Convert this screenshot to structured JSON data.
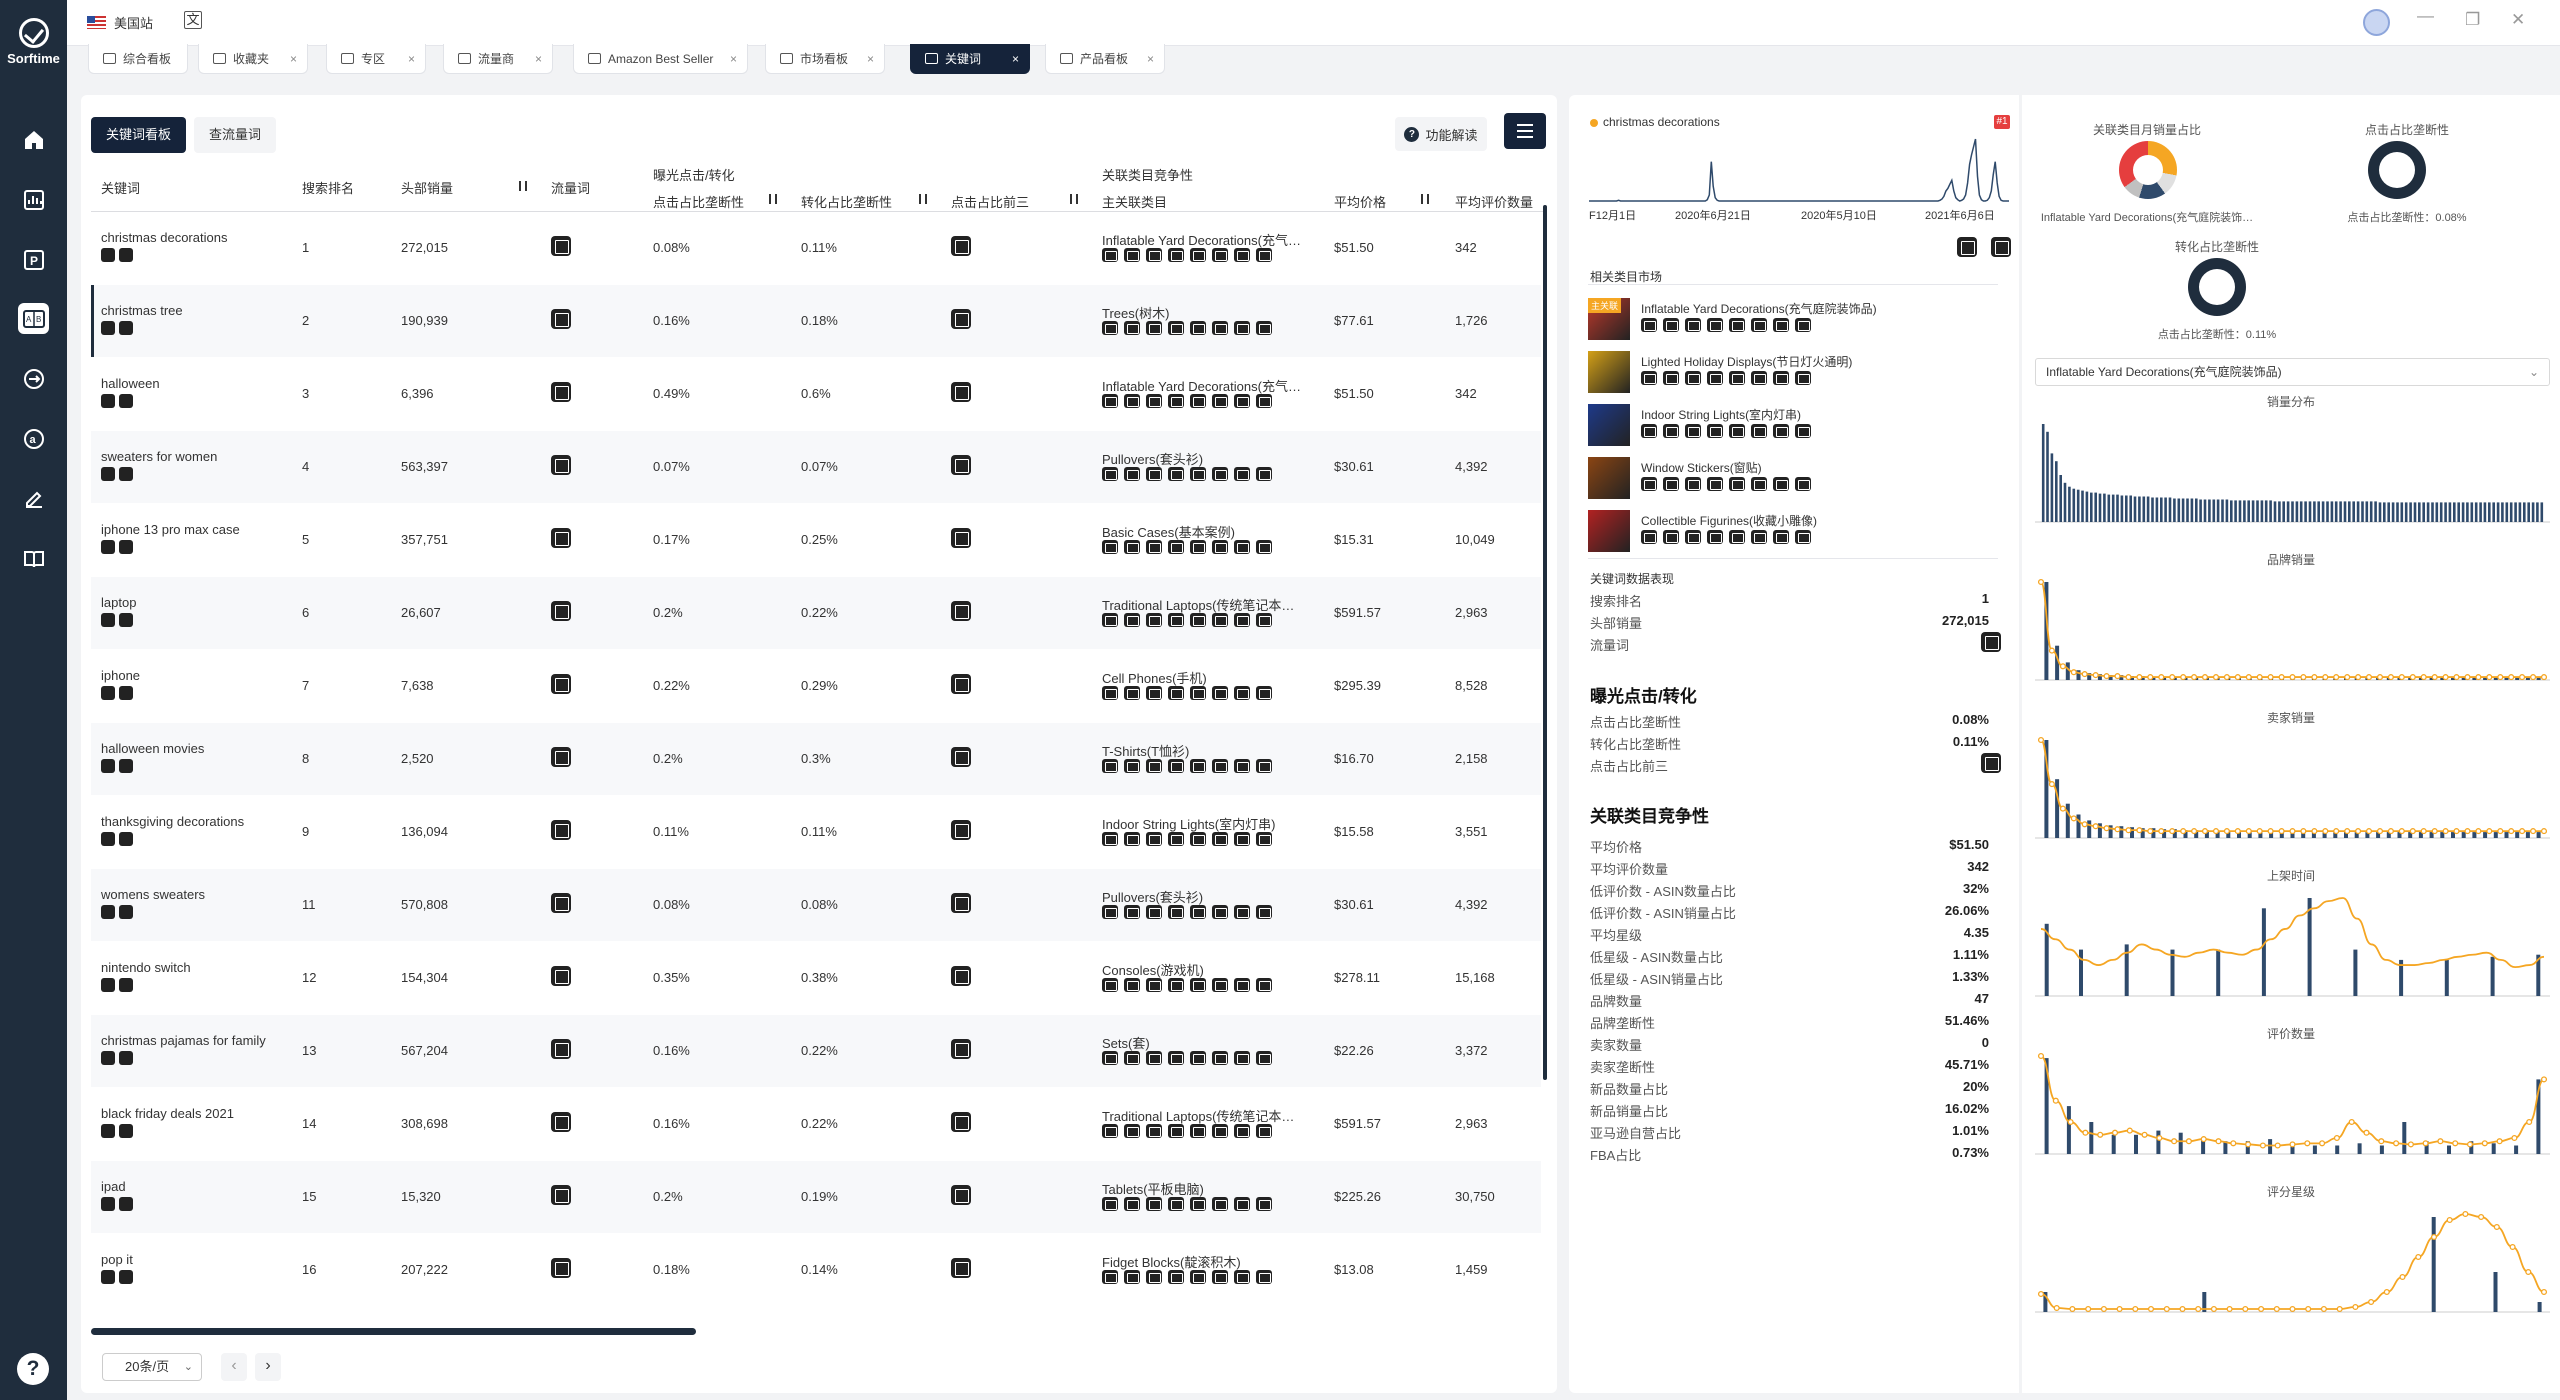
{
  "app": {
    "name": "Sorftime",
    "site": "美国站",
    "translate": "文",
    "help": "?"
  },
  "tabs": [
    {
      "label": "综合看板"
    },
    {
      "label": "收藏夹"
    },
    {
      "label": "专区"
    },
    {
      "label": "流量商"
    },
    {
      "label": "Amazon Best Seller"
    },
    {
      "label": "市场看板"
    },
    {
      "label": "关键词"
    },
    {
      "label": "产品看板"
    }
  ],
  "tab_close": "×",
  "toolbar": {
    "keyword_board": "关键词看板",
    "traffic_query": "查流量词",
    "func_help": "功能解读"
  },
  "table": {
    "group_headers": {
      "exposure": "曝光点击/转化",
      "competition": "关联类目竞争性"
    },
    "headers": {
      "keyword": "关键词",
      "rank": "搜索排名",
      "top_sales": "头部销量",
      "traffic": "流量词",
      "click_change": "点击占比垄断性",
      "conv_change": "转化占比垄断性",
      "click_top3": "点击占比前三",
      "main_cat": "主关联类目",
      "avg_price": "平均价格",
      "avg_reviews": "平均评价数量"
    },
    "rows": [
      {
        "kw": "christmas decorations",
        "rank": "1",
        "sales": "272,015",
        "click": "0.08%",
        "conv": "0.11%",
        "cat": "Inflatable Yard Decorations(充气…",
        "price": "$51.50",
        "reviews": "342"
      },
      {
        "kw": "christmas tree",
        "rank": "2",
        "sales": "190,939",
        "click": "0.16%",
        "conv": "0.18%",
        "cat": "Trees(树木)",
        "price": "$77.61",
        "reviews": "1,726"
      },
      {
        "kw": "halloween",
        "rank": "3",
        "sales": "6,396",
        "click": "0.49%",
        "conv": "0.6%",
        "cat": "Inflatable Yard Decorations(充气…",
        "price": "$51.50",
        "reviews": "342"
      },
      {
        "kw": "sweaters for women",
        "rank": "4",
        "sales": "563,397",
        "click": "0.07%",
        "conv": "0.07%",
        "cat": "Pullovers(套头衫)",
        "price": "$30.61",
        "reviews": "4,392"
      },
      {
        "kw": "iphone 13 pro max case",
        "rank": "5",
        "sales": "357,751",
        "click": "0.17%",
        "conv": "0.25%",
        "cat": "Basic Cases(基本案例)",
        "price": "$15.31",
        "reviews": "10,049"
      },
      {
        "kw": "laptop",
        "rank": "6",
        "sales": "26,607",
        "click": "0.2%",
        "conv": "0.22%",
        "cat": "Traditional Laptops(传统笔记本…",
        "price": "$591.57",
        "reviews": "2,963"
      },
      {
        "kw": "iphone",
        "rank": "7",
        "sales": "7,638",
        "click": "0.22%",
        "conv": "0.29%",
        "cat": "Cell Phones(手机)",
        "price": "$295.39",
        "reviews": "8,528"
      },
      {
        "kw": "halloween movies",
        "rank": "8",
        "sales": "2,520",
        "click": "0.2%",
        "conv": "0.3%",
        "cat": "T-Shirts(T恤衫)",
        "price": "$16.70",
        "reviews": "2,158"
      },
      {
        "kw": "thanksgiving decorations",
        "rank": "9",
        "sales": "136,094",
        "click": "0.11%",
        "conv": "0.11%",
        "cat": "Indoor String Lights(室内灯串)",
        "price": "$15.58",
        "reviews": "3,551"
      },
      {
        "kw": "womens sweaters",
        "rank": "11",
        "sales": "570,808",
        "click": "0.08%",
        "conv": "0.08%",
        "cat": "Pullovers(套头衫)",
        "price": "$30.61",
        "reviews": "4,392"
      },
      {
        "kw": "nintendo switch",
        "rank": "12",
        "sales": "154,304",
        "click": "0.35%",
        "conv": "0.38%",
        "cat": "Consoles(游戏机)",
        "price": "$278.11",
        "reviews": "15,168"
      },
      {
        "kw": "christmas pajamas for family",
        "rank": "13",
        "sales": "567,204",
        "click": "0.16%",
        "conv": "0.22%",
        "cat": "Sets(套)",
        "price": "$22.26",
        "reviews": "3,372"
      },
      {
        "kw": "black friday deals 2021",
        "rank": "14",
        "sales": "308,698",
        "click": "0.16%",
        "conv": "0.22%",
        "cat": "Traditional Laptops(传统笔记本…",
        "price": "$591.57",
        "reviews": "2,963"
      },
      {
        "kw": "ipad",
        "rank": "15",
        "sales": "15,320",
        "click": "0.2%",
        "conv": "0.19%",
        "cat": "Tablets(平板电脑)",
        "price": "$225.26",
        "reviews": "30,750"
      },
      {
        "kw": "pop it",
        "rank": "16",
        "sales": "207,222",
        "click": "0.18%",
        "conv": "0.14%",
        "cat": "Fidget Blocks(靛滚积木)",
        "price": "$13.08",
        "reviews": "1,459"
      }
    ]
  },
  "pagination": {
    "page_size": "20条/页",
    "prev": "‹",
    "next": "›"
  },
  "detail": {
    "keyword": "christmas decorations",
    "trend_badge": "#1",
    "trend_dates": [
      "F12月1日",
      "2020年6月21日",
      "2020年5月10日",
      "2021年6月6日"
    ],
    "trend_series": [
      3,
      3,
      3,
      3,
      3,
      3,
      3,
      3,
      3,
      3,
      3,
      3,
      3,
      3,
      3,
      4,
      3,
      3,
      3,
      3,
      3,
      3,
      3,
      3,
      3,
      3,
      3,
      3,
      3,
      3,
      3,
      3,
      3,
      3,
      3,
      3,
      3,
      3,
      3,
      3,
      3,
      3,
      3,
      3,
      3,
      3,
      3,
      3,
      3,
      3,
      3,
      3,
      3,
      3,
      3,
      3,
      3,
      3,
      3,
      3,
      5,
      12,
      62,
      25,
      8,
      4,
      3,
      3,
      3,
      3,
      3,
      3,
      3,
      3,
      3,
      3,
      3,
      3,
      3,
      3,
      3,
      3,
      3,
      3,
      3,
      3,
      3,
      3,
      3,
      3,
      3,
      3,
      3,
      3,
      3,
      3,
      3,
      3,
      3,
      3,
      3,
      3,
      3,
      3,
      3,
      3,
      3,
      3,
      3,
      3,
      3,
      3,
      3,
      3,
      3,
      3,
      3,
      3,
      3,
      3,
      3,
      3,
      3,
      3,
      3,
      3,
      3,
      3,
      3,
      3,
      3,
      3,
      3,
      3,
      3,
      3,
      3,
      3,
      3,
      3,
      3,
      3,
      3,
      3,
      3,
      3,
      3,
      3,
      3,
      3,
      3,
      3,
      3,
      3,
      3,
      3,
      3,
      3,
      3,
      3,
      3,
      3,
      3,
      3,
      3,
      3,
      3,
      3,
      3,
      3,
      3,
      3,
      3,
      3,
      3,
      3,
      3,
      3,
      4,
      6,
      10,
      18,
      22,
      28,
      34,
      18,
      8,
      5,
      3,
      4,
      6,
      12,
      30,
      58,
      72,
      84,
      96,
      40,
      12,
      5,
      3,
      3,
      4,
      8,
      18,
      42,
      62,
      30,
      10,
      4,
      3,
      3,
      3,
      3
    ],
    "related_market_title": "相关类目市场",
    "related": [
      {
        "tag": "主关联",
        "name": "Inflatable Yard Decorations(充气庭院装饰品)",
        "color": "#c0392b"
      },
      {
        "tag": "",
        "name": "Lighted Holiday Displays(节日灯火通明)",
        "color": "#d4a017"
      },
      {
        "tag": "",
        "name": "Indoor String Lights(室内灯串)",
        "color": "#1e3a8a"
      },
      {
        "tag": "",
        "name": "Window Stickers(窗贴)",
        "color": "#8b4513"
      },
      {
        "tag": "",
        "name": "Collectible Figurines(收藏小雕像)",
        "color": "#b22222"
      }
    ],
    "kw_perf_title": "关键词数据表现",
    "kw_perf": [
      {
        "label": "搜索排名",
        "value": "1"
      },
      {
        "label": "头部销量",
        "value": "272,015"
      },
      {
        "label": "流量词",
        "value": ""
      }
    ],
    "exposure_title": "曝光点击/转化",
    "exposure": [
      {
        "label": "点击占比垄断性",
        "value": "0.08%"
      },
      {
        "label": "转化占比垄断性",
        "value": "0.11%"
      },
      {
        "label": "点击占比前三",
        "value": ""
      }
    ],
    "comp_title": "关联类目竞争性",
    "comp": [
      {
        "label": "平均价格",
        "value": "$51.50"
      },
      {
        "label": "平均评价数量",
        "value": "342"
      },
      {
        "label": "低评价数 - ASIN数量占比",
        "value": "32%"
      },
      {
        "label": "低评价数 - ASIN销量占比",
        "value": "26.06%"
      },
      {
        "label": "平均星级",
        "value": "4.35"
      },
      {
        "label": "低星级 - ASIN数量占比",
        "value": "1.11%"
      },
      {
        "label": "低星级 - ASIN销量占比",
        "value": "1.33%"
      },
      {
        "label": "品牌数量",
        "value": "47"
      },
      {
        "label": "品牌垄断性",
        "value": "51.46%"
      },
      {
        "label": "卖家数量",
        "value": "0"
      },
      {
        "label": "卖家垄断性",
        "value": "45.71%"
      },
      {
        "label": "新品数量占比",
        "value": "20%"
      },
      {
        "label": "新品销量占比",
        "value": "16.02%"
      },
      {
        "label": "亚马逊自营占比",
        "value": "1.01%"
      },
      {
        "label": "FBA占比",
        "value": "0.73%"
      }
    ]
  },
  "charts": {
    "donut1_title": "关联类目月销量占比",
    "donut1_caption": "Inflatable Yard Decorations(充气庭院装饰…",
    "donut2_title": "点击占比垄断性",
    "donut2_caption": "点击占比垄断性：0.08%",
    "donut3_title": "转化占比垄断性",
    "donut3_caption": "点击占比垄断性：0.11%",
    "category_select": "Inflatable Yard Decorations(充气庭院装饰品)",
    "select_arrow": "⌄",
    "sales_dist_title": "销量分布",
    "brand_title": "品牌销量",
    "seller_title": "卖家销量",
    "launch_title": "上架时间",
    "review_title": "评价数量",
    "rating_title": "评分星级",
    "colors": {
      "bar": "#2f4a6b",
      "line": "#f5a623"
    }
  },
  "chart_data": [
    {
      "type": "bar",
      "title": "销量分布",
      "values": [
        100,
        92,
        70,
        62,
        48,
        40,
        36,
        34,
        33,
        32,
        31,
        30,
        30,
        29,
        29,
        28,
        28,
        28,
        27,
        27,
        27,
        26,
        26,
        26,
        26,
        25,
        25,
        25,
        25,
        25,
        24,
        24,
        24,
        24,
        24,
        24,
        23,
        23,
        23,
        23,
        23,
        23,
        23,
        22,
        22,
        22,
        22,
        22,
        22,
        22,
        22,
        22,
        22,
        21,
        21,
        21,
        21,
        21,
        21,
        21,
        21,
        21,
        21,
        21,
        21,
        21,
        21,
        21,
        21,
        21,
        21,
        21,
        21,
        21,
        21,
        21,
        21,
        20,
        20,
        20,
        20,
        20,
        20,
        20,
        20,
        20,
        20,
        20,
        20,
        20,
        20,
        20,
        20,
        20,
        20,
        20,
        20,
        20,
        20,
        20,
        20,
        20,
        20,
        20,
        20,
        20,
        20,
        20,
        20,
        20,
        20,
        20,
        20,
        20,
        20
      ]
    },
    {
      "type": "bar",
      "title": "品牌销量",
      "values": [
        100,
        35,
        18,
        10,
        7,
        6,
        5,
        5,
        4,
        4,
        3,
        3,
        3,
        3,
        2,
        2,
        2,
        2,
        2,
        2,
        2,
        2,
        2,
        2,
        2,
        2,
        2,
        2,
        2,
        2,
        2,
        2,
        2,
        2,
        2,
        2,
        2,
        2,
        2,
        2,
        2,
        2,
        2,
        2,
        2,
        2,
        2
      ],
      "line": [
        100,
        30,
        14,
        8,
        6,
        5,
        4,
        4,
        3,
        3,
        3,
        3,
        3,
        3,
        3,
        3,
        3,
        3,
        3,
        3,
        3,
        3,
        3,
        3,
        3,
        3,
        3,
        3,
        3,
        3,
        3,
        3,
        3,
        3,
        3,
        3,
        3,
        3,
        3,
        3,
        3,
        3,
        3,
        3,
        3,
        3,
        3
      ]
    },
    {
      "type": "bar",
      "title": "卖家销量",
      "values": [
        100,
        60,
        35,
        24,
        18,
        15,
        13,
        12,
        11,
        10,
        10,
        9,
        9,
        8,
        8,
        8,
        7,
        7,
        7,
        7,
        7,
        6,
        6,
        6,
        6,
        6,
        6,
        6,
        6,
        6,
        6,
        6,
        6,
        6,
        6,
        6,
        6,
        6,
        6,
        6,
        6,
        6,
        6,
        6,
        6,
        6,
        6
      ],
      "line": [
        100,
        55,
        30,
        20,
        14,
        12,
        10,
        9,
        8,
        8,
        7,
        7,
        7,
        7,
        7,
        7,
        7,
        7,
        7,
        7,
        7,
        7,
        7,
        7,
        7,
        7,
        7,
        7,
        7,
        7,
        7,
        7,
        7,
        7,
        7,
        7,
        7,
        7,
        7,
        7,
        7,
        7,
        7,
        7,
        7,
        7,
        7
      ]
    },
    {
      "type": "bar",
      "title": "上架时间",
      "values": [
        70,
        0,
        0,
        45,
        0,
        0,
        0,
        50,
        0,
        0,
        0,
        45,
        0,
        0,
        0,
        45,
        0,
        0,
        0,
        85,
        0,
        0,
        0,
        95,
        0,
        0,
        0,
        45,
        0,
        0,
        0,
        35,
        0,
        0,
        0,
        35,
        0,
        0,
        0,
        38,
        0,
        0,
        0,
        40
      ],
      "line": [
        65,
        55,
        45,
        35,
        30,
        35,
        42,
        50,
        45,
        40,
        38,
        42,
        45,
        42,
        40,
        45,
        55,
        65,
        78,
        85,
        92,
        95,
        75,
        50,
        35,
        30,
        30,
        32,
        35,
        38,
        40,
        42,
        35,
        28,
        30,
        38
      ]
    },
    {
      "type": "bar",
      "title": "评价数量",
      "values": [
        90,
        0,
        45,
        0,
        30,
        0,
        18,
        0,
        18,
        0,
        22,
        0,
        20,
        0,
        15,
        0,
        12,
        0,
        12,
        0,
        14,
        0,
        10,
        0,
        8,
        0,
        8,
        0,
        10,
        0,
        8,
        0,
        30,
        0,
        12,
        0,
        8,
        0,
        12,
        0,
        10,
        0,
        8,
        0,
        70
      ],
      "line": [
        92,
        50,
        30,
        20,
        18,
        20,
        22,
        18,
        15,
        12,
        12,
        14,
        12,
        10,
        9,
        8,
        8,
        9,
        10,
        10,
        15,
        30,
        20,
        12,
        10,
        9,
        10,
        12,
        10,
        9,
        10,
        12,
        15,
        30,
        70
      ]
    },
    {
      "type": "bar",
      "title": "评分星级",
      "values": [
        20,
        0,
        0,
        0,
        0,
        0,
        0,
        0,
        0,
        0,
        0,
        0,
        0,
        0,
        0,
        0,
        0,
        0,
        20,
        0,
        0,
        0,
        0,
        0,
        0,
        0,
        0,
        0,
        0,
        0,
        0,
        0,
        0,
        0,
        0,
        0,
        0,
        0,
        0,
        0,
        0,
        0,
        0,
        0,
        95,
        0,
        0,
        0,
        0,
        0,
        0,
        40,
        0,
        0,
        0,
        0,
        10
      ],
      "line": [
        18,
        4,
        3,
        3,
        3,
        3,
        3,
        3,
        3,
        3,
        3,
        3,
        3,
        3,
        3,
        3,
        3,
        3,
        3,
        3,
        5,
        10,
        20,
        35,
        55,
        75,
        92,
        98,
        95,
        85,
        65,
        40,
        20
      ]
    }
  ]
}
